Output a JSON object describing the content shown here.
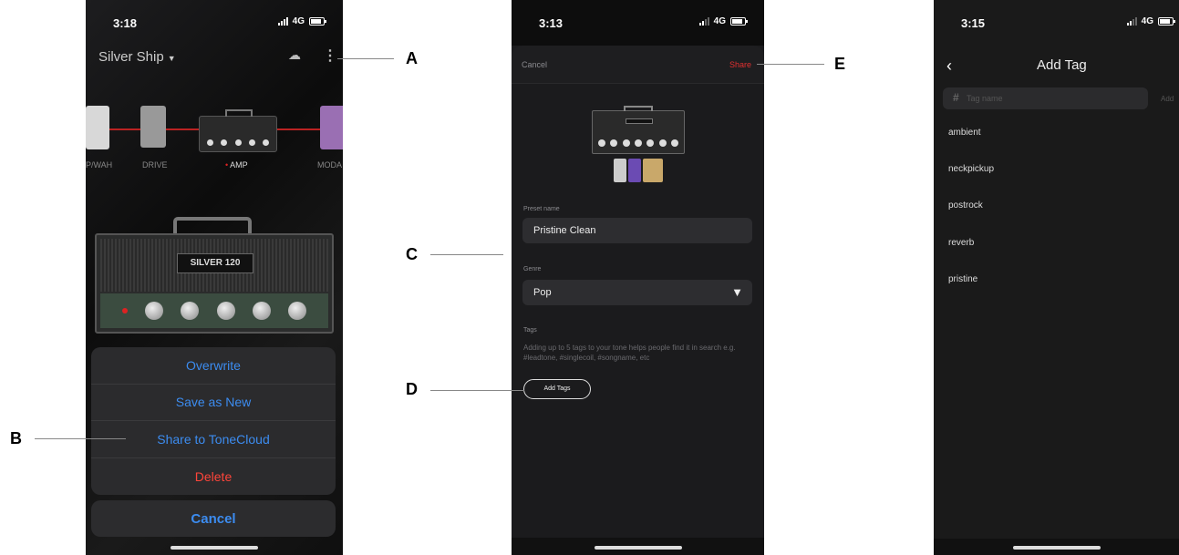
{
  "screen1": {
    "status": {
      "time": "3:18",
      "network": "4G"
    },
    "preset_title": "Silver Ship",
    "chain_labels": [
      "P/WAH",
      "DRIVE",
      "AMP",
      "MODA"
    ],
    "amp_logo": "SILVER 120",
    "action_sheet": {
      "items": [
        "Overwrite",
        "Save as New",
        "Share to ToneCloud",
        "Delete"
      ],
      "cancel": "Cancel"
    },
    "icons": [
      "cloud-sync-icon",
      "more-vertical-icon",
      "chevron-down-icon"
    ]
  },
  "screen2": {
    "status": {
      "time": "3:13",
      "network": "4G"
    },
    "cancel": "Cancel",
    "share": "Share",
    "preset_name_label": "Preset name",
    "preset_name_value": "Pristine Clean",
    "genre_label": "Genre",
    "genre_value": "Pop",
    "tags_label": "Tags",
    "tags_help": "Adding up to 5 tags to your tone helps people find it in search e.g. #leadtone, #singlecoil, #songname, etc",
    "add_tags": "Add Tags"
  },
  "screen3": {
    "status": {
      "time": "3:15",
      "network": "4G"
    },
    "title": "Add Tag",
    "search_placeholder": "Tag name",
    "add": "Add",
    "tags": [
      "ambient",
      "neckpickup",
      "postrock",
      "reverb",
      "pristine"
    ]
  },
  "callouts": {
    "a": "A",
    "b": "B",
    "c": "C",
    "d": "D",
    "e": "E"
  },
  "colors": {
    "ios_blue": "#3c8cf0",
    "destructive_red": "#ff453a",
    "share_red": "#e03030"
  }
}
